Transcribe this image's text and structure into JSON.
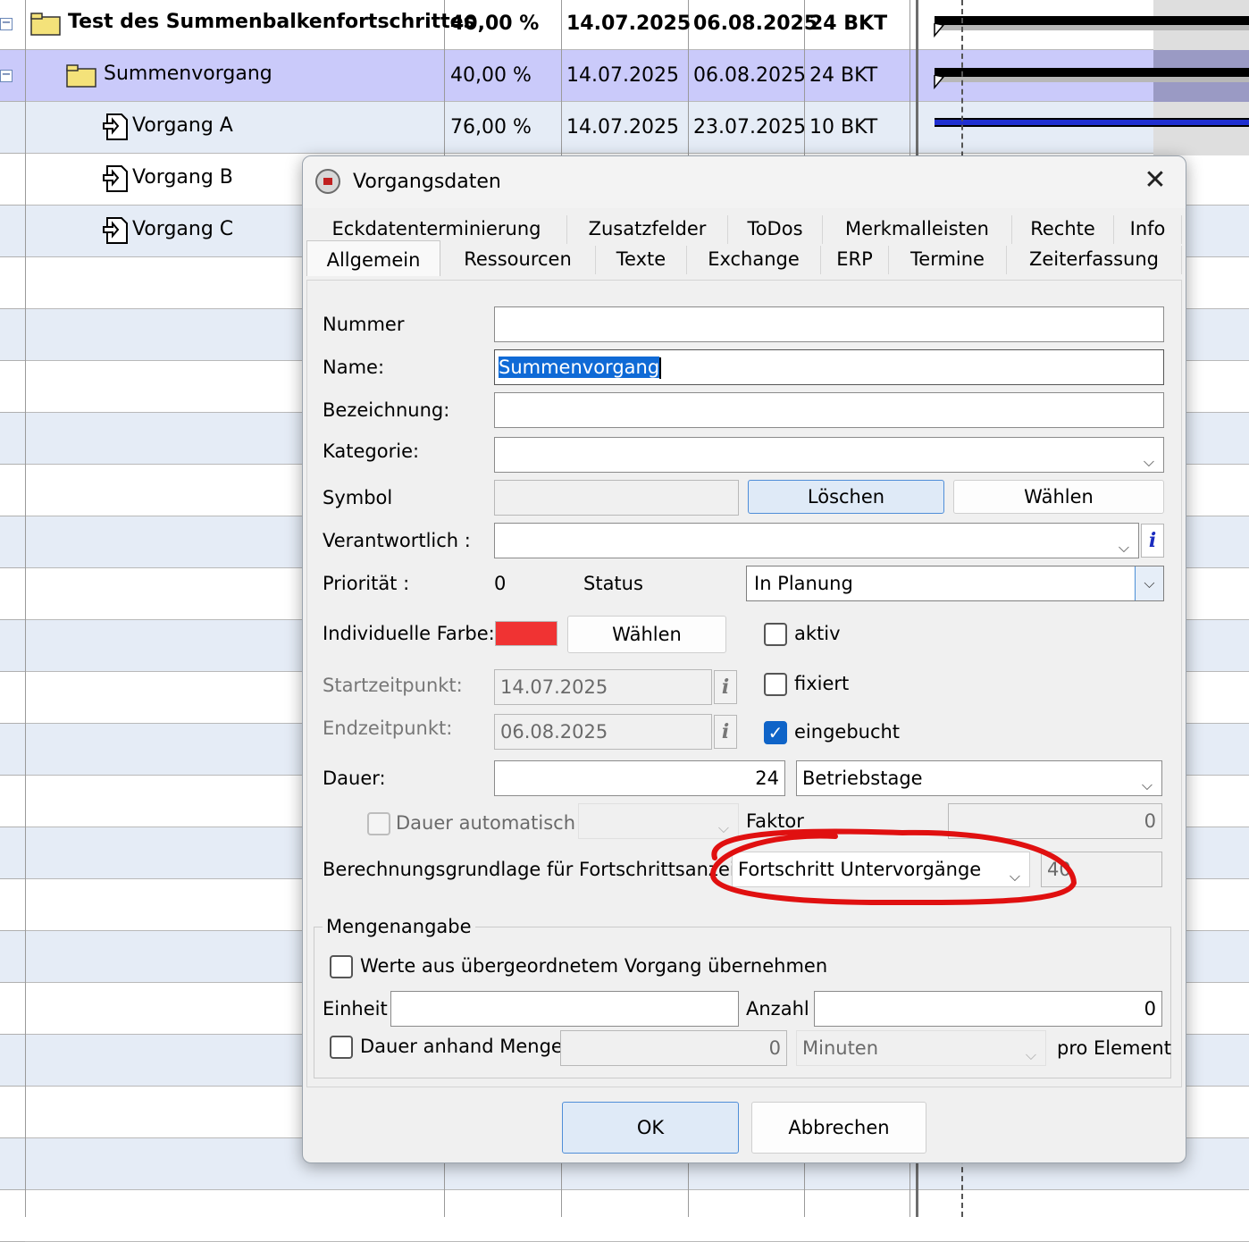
{
  "table": {
    "rows": [
      {
        "name": "Test des Summenbalkenfortschrittes",
        "progress": "40,00 %",
        "start": "14.07.2025",
        "end": "06.08.2025",
        "duration": "24 BKT"
      },
      {
        "name": "Summenvorgang",
        "progress": "40,00 %",
        "start": "14.07.2025",
        "end": "06.08.2025",
        "duration": "24 BKT"
      },
      {
        "name": "Vorgang A",
        "progress": "76,00 %",
        "start": "14.07.2025",
        "end": "23.07.2025",
        "duration": "10 BKT"
      },
      {
        "name": "Vorgang B"
      },
      {
        "name": "Vorgang C"
      }
    ],
    "collapse_symbol": "−"
  },
  "dialog": {
    "title": "Vorgangsdaten",
    "close_icon": "close-icon",
    "tabs_row1": [
      "Eckdatenterminierung",
      "Zusatzfelder",
      "ToDos",
      "Merkmalleisten",
      "Rechte",
      "Info"
    ],
    "tabs_row2": [
      "Allgemein",
      "Ressourcen",
      "Texte",
      "Exchange",
      "ERP",
      "Termine",
      "Zeiterfassung"
    ],
    "active_tab": "Allgemein",
    "labels": {
      "nummer": "Nummer",
      "name": "Name:",
      "bezeichnung": "Bezeichnung:",
      "kategorie": "Kategorie:",
      "symbol": "Symbol",
      "verantwortlich": "Verantwortlich :",
      "prioritaet": "Priorität :",
      "status": "Status",
      "farbe": "Individuelle Farbe:",
      "startzeitpunkt": "Startzeitpunkt:",
      "endzeitpunkt": "Endzeitpunkt:",
      "dauer": "Dauer:",
      "faktor": "Faktor",
      "berechnung": "Berechnungsgrundlage für Fortschrittsanzeige",
      "mengenangabe": "Mengenangabe",
      "einheit": "Einheit",
      "anzahl": "Anzahl",
      "pro_element": "pro Element"
    },
    "values": {
      "nummer": "",
      "name": "Summenvorgang",
      "bezeichnung": "",
      "kategorie": "",
      "verantwortlich": "",
      "prioritaet": "0",
      "status": "In Planung",
      "farbe": "#f03333",
      "startzeitpunkt": "14.07.2025",
      "endzeitpunkt": "06.08.2025",
      "dauer": "24",
      "dauer_einheit": "Betriebstage",
      "faktor": "0",
      "berechnung": "Fortschritt Untervorgänge",
      "berechnung_wert": "40",
      "einheit": "",
      "anzahl": "0",
      "menge_dauer": "0",
      "menge_einheit": "Minuten"
    },
    "buttons": {
      "loeschen": "Löschen",
      "waehlen_symbol": "Wählen",
      "waehlen_farbe": "Wählen",
      "ok": "OK",
      "abbrechen": "Abbrechen",
      "info": "i"
    },
    "checkboxes": {
      "aktiv": {
        "label": "aktiv",
        "checked": false
      },
      "fixiert": {
        "label": "fixiert",
        "checked": false
      },
      "eingebucht": {
        "label": "eingebucht",
        "checked": true
      },
      "dauer_automatisch": {
        "label": "Dauer automatisch",
        "checked": false
      },
      "werte_uebernehmen": {
        "label": "Werte aus übergeordnetem Vorgang übernehmen",
        "checked": false
      },
      "dauer_menge": {
        "label": "Dauer anhand Menge",
        "checked": false
      }
    },
    "checkmark": "✓",
    "chevron": "⌵"
  },
  "colors": {
    "selected_row": "#cacafa",
    "alt_row": "#e5ecf6",
    "highlight": "#0f6ad6",
    "annotation_red": "#e01010"
  }
}
